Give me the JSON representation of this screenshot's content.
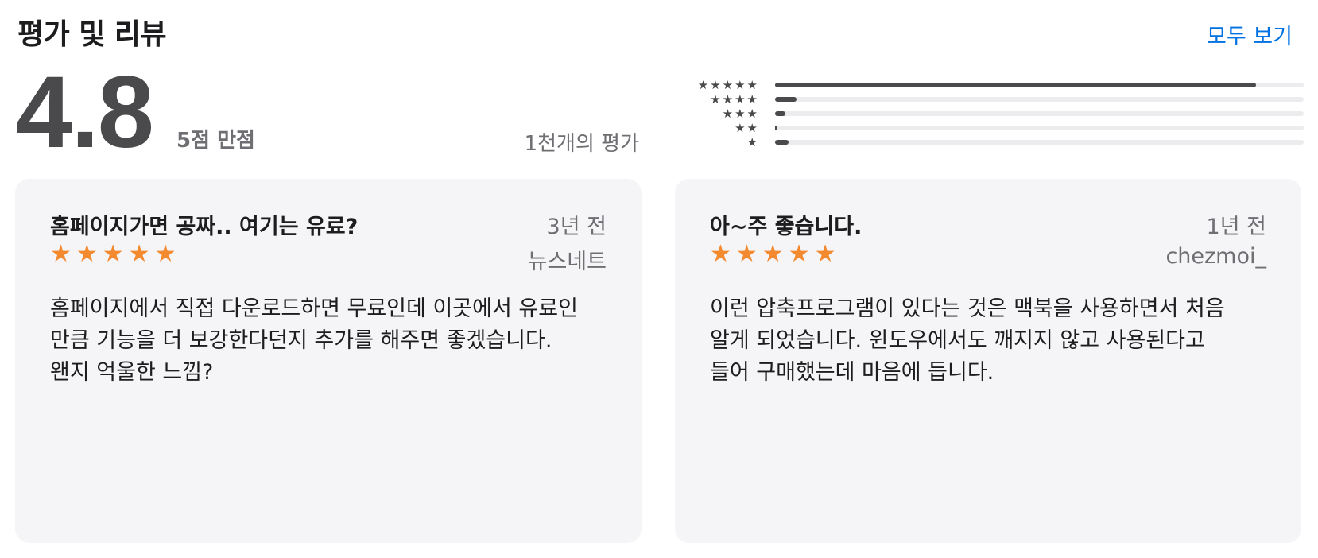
{
  "header": {
    "title": "평가 및 리뷰",
    "see_all": "모두 보기"
  },
  "summary": {
    "score": "4.8",
    "out_of": "5점 만점",
    "rating_count": "1천개의 평가",
    "histogram": [
      {
        "stars": "★★★★★",
        "fraction": 0.91
      },
      {
        "stars": "★★★★",
        "fraction": 0.04
      },
      {
        "stars": "★★★",
        "fraction": 0.02
      },
      {
        "stars": "★★",
        "fraction": 0.003
      },
      {
        "stars": "★",
        "fraction": 0.025
      }
    ]
  },
  "reviews": [
    {
      "title": "홈페이지가면 공짜.. 여기는 유료?",
      "date": "3년 전",
      "author": "뉴스네트",
      "stars": "★★★★★",
      "rating": 5,
      "body": "홈페이지에서 직접 다운로드하면 무료인데 이곳에서 유료인\n만큼 기능을 더 보강한다던지 추가를 해주면 좋겠습니다.\n왠지 억울한 느낌?"
    },
    {
      "title": "아~주 좋습니다.",
      "date": "1년 전",
      "author": "chezmoi_",
      "stars": "★★★★★",
      "rating": 5,
      "body": "이런 압축프로그램이 있다는 것은 맥북을 사용하면서 처음\n알게 되었습니다. 윈도우에서도 깨지지 않고 사용된다고\n들어 구매했는데 마음에 듭니다."
    }
  ],
  "colors": {
    "accent": "#0071e3",
    "star": "#f38a2f",
    "card_bg": "#f5f5f7",
    "bar": "#4a4a4c"
  }
}
